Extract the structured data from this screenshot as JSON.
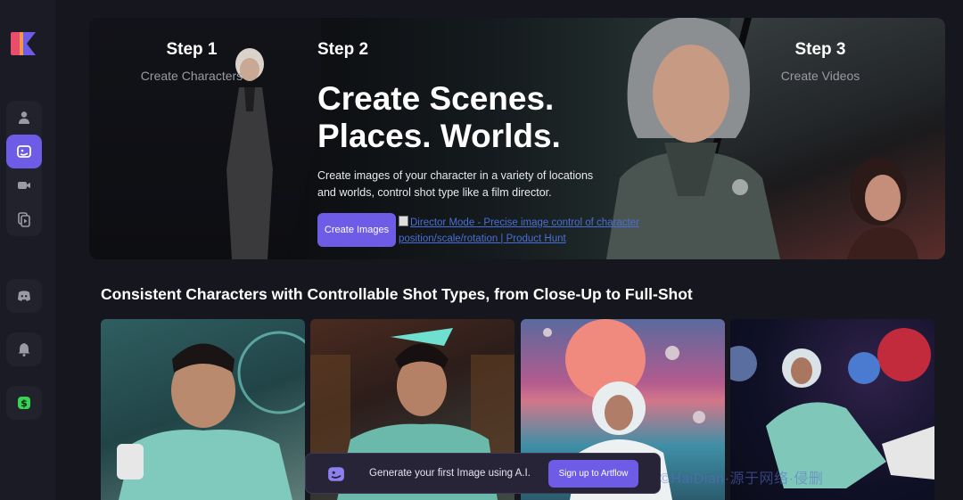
{
  "sidebar": {
    "items": [
      {
        "name": "characters",
        "icon": "person-icon",
        "active": false
      },
      {
        "name": "scenes",
        "icon": "image-face-icon",
        "active": true
      },
      {
        "name": "video",
        "icon": "video-camera-icon",
        "active": false
      },
      {
        "name": "storyboard",
        "icon": "play-stack-icon",
        "active": false
      },
      {
        "name": "discord",
        "icon": "discord-icon",
        "active": false
      },
      {
        "name": "notifications",
        "icon": "bell-icon",
        "active": false
      },
      {
        "name": "credits",
        "icon": "dollar-icon",
        "active": false
      }
    ]
  },
  "hero": {
    "step1": {
      "title": "Step 1",
      "subtitle": "Create Characters"
    },
    "step2": {
      "title": "Step 2"
    },
    "step3": {
      "title": "Step 3",
      "subtitle": "Create Videos"
    },
    "headline_line1": "Create Scenes.",
    "headline_line2": "Places. Worlds.",
    "description": "Create images of your character in a variety of locations and worlds, control shot type like a film director.",
    "cta_label": "Create Images",
    "broken_image_alt": "Director Mode - Precise image control of character position/scale/rotation | Product Hunt"
  },
  "section": {
    "title": "Consistent Characters with Controllable Shot Types, from Close-Up to Full-Shot"
  },
  "toast": {
    "text": "Generate your first Image using A.I.",
    "button_label": "Sign up to Artflow"
  },
  "watermark": "©HaiDian·源于网络·侵删",
  "colors": {
    "accent": "#6e5ce6",
    "background": "#16161f",
    "sidebar": "#1b1b25"
  }
}
